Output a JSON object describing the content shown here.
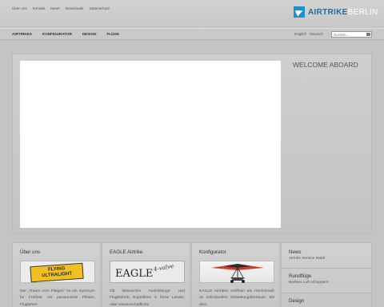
{
  "top_links": [
    "Über uns",
    "Kontakt",
    "News",
    "Downloads",
    "Datenschutz"
  ],
  "logo": {
    "part1": "AIRTRIKE",
    "part2": "BERLIN"
  },
  "nav": [
    "AIRTRIKES",
    "KONFIGURATOR",
    "DESIGN",
    "FLÜGE"
  ],
  "languages": [
    "English",
    "Deutsch"
  ],
  "search": {
    "placeholder": "Suchen..."
  },
  "hero": {
    "welcome": "WELCOME ABOARD"
  },
  "columns": [
    {
      "title": "Über uns",
      "image_text": [
        "FLYING",
        "ULTRALIGHT",
        "AIRCRAFT"
      ],
      "text": "Der „Traum vom Fliegen“ ist ein Synonym für Freiheit. Als passionierte Piloten, Fluglehrer"
    },
    {
      "title": "EAGLE Airtrike",
      "image_text": [
        "EAGLE",
        "4-valve"
      ],
      "text": "Ob klassischer Ausbildungs- und Flugbetrieb, Expedition in ferne Länder, oder wissenschaftliche"
    },
    {
      "title": "Konfigurator",
      "text": "EAGLE Airtrikes eröffnen ein Höchstmaß an individuellen Gestaltungsfreiraum. Mit dem"
    }
  ],
  "side": [
    {
      "title": "News",
      "sub": "Airtrike Service Mobil"
    },
    {
      "title": "Rundflüge",
      "sub": "Berliner Luft schuppern"
    },
    {
      "title": "Design",
      "sub": ""
    }
  ],
  "colors": {
    "brand_blue": "#1e8fd0",
    "background": "#c4c4c4"
  }
}
